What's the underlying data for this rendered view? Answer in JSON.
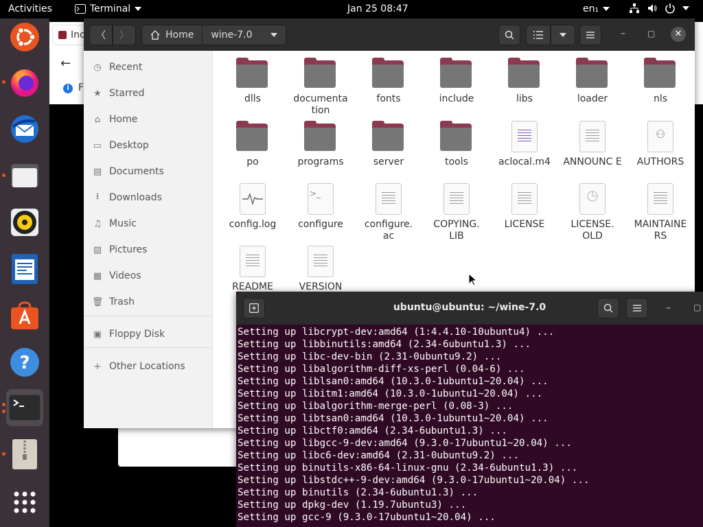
{
  "topbar": {
    "activities": "Activities",
    "app_name": "Terminal",
    "clock": "Jan 25  08:47",
    "language": "en₁"
  },
  "background_window": {
    "tab_label": "Inc",
    "info_text": "F"
  },
  "file_manager": {
    "path": [
      "Home",
      "wine-7.0"
    ],
    "sidebar": [
      {
        "label": "Recent",
        "icon": "clock-icon"
      },
      {
        "label": "Starred",
        "icon": "star-icon"
      },
      {
        "label": "Home",
        "icon": "home-icon"
      },
      {
        "label": "Desktop",
        "icon": "desktop-icon"
      },
      {
        "label": "Documents",
        "icon": "documents-icon"
      },
      {
        "label": "Downloads",
        "icon": "downloads-icon"
      },
      {
        "label": "Music",
        "icon": "music-icon"
      },
      {
        "label": "Pictures",
        "icon": "pictures-icon"
      },
      {
        "label": "Videos",
        "icon": "videos-icon"
      },
      {
        "label": "Trash",
        "icon": "trash-icon"
      },
      {
        "label": "Floppy Disk",
        "icon": "floppy-icon"
      },
      {
        "label": "Other Locations",
        "icon": "plus-icon"
      }
    ],
    "items": [
      {
        "name": "dlls",
        "type": "folder"
      },
      {
        "name": "documenta tion",
        "type": "folder"
      },
      {
        "name": "fonts",
        "type": "folder"
      },
      {
        "name": "include",
        "type": "folder"
      },
      {
        "name": "libs",
        "type": "folder"
      },
      {
        "name": "loader",
        "type": "folder"
      },
      {
        "name": "nls",
        "type": "folder"
      },
      {
        "name": "po",
        "type": "folder"
      },
      {
        "name": "programs",
        "type": "folder"
      },
      {
        "name": "server",
        "type": "folder"
      },
      {
        "name": "tools",
        "type": "folder"
      },
      {
        "name": "aclocal.m4",
        "type": "colored-text"
      },
      {
        "name": "ANNOUNC E",
        "type": "text"
      },
      {
        "name": "AUTHORS",
        "type": "people"
      },
      {
        "name": "config.log",
        "type": "log"
      },
      {
        "name": "configure",
        "type": "script"
      },
      {
        "name": "configure. ac",
        "type": "text"
      },
      {
        "name": "COPYING. LIB",
        "type": "text"
      },
      {
        "name": "LICENSE",
        "type": "text"
      },
      {
        "name": "LICENSE. OLD",
        "type": "history"
      },
      {
        "name": "MAINTAINE RS",
        "type": "text"
      },
      {
        "name": "README",
        "type": "text"
      },
      {
        "name": "VERSION",
        "type": "text"
      }
    ]
  },
  "terminal": {
    "title": "ubuntu@ubuntu: ~/wine-7.0",
    "lines": [
      "Setting up libcrypt-dev:amd64 (1:4.4.10-10ubuntu4) ...",
      "Setting up libbinutils:amd64 (2.34-6ubuntu1.3) ...",
      "Setting up libc-dev-bin (2.31-0ubuntu9.2) ...",
      "Setting up libalgorithm-diff-xs-perl (0.04-6) ...",
      "Setting up liblsan0:amd64 (10.3.0-1ubuntu1~20.04) ...",
      "Setting up libitm1:amd64 (10.3.0-1ubuntu1~20.04) ...",
      "Setting up libalgorithm-merge-perl (0.08-3) ...",
      "Setting up libtsan0:amd64 (10.3.0-1ubuntu1~20.04) ...",
      "Setting up libctf0:amd64 (2.34-6ubuntu1.3) ...",
      "Setting up libgcc-9-dev:amd64 (9.3.0-17ubuntu1~20.04) ...",
      "Setting up libc6-dev:amd64 (2.31-0ubuntu9.2) ...",
      "Setting up binutils-x86-64-linux-gnu (2.34-6ubuntu1.3) ...",
      "Setting up libstdc++-9-dev:amd64 (9.3.0-17ubuntu1~20.04) ...",
      "Setting up binutils (2.34-6ubuntu1.3) ...",
      "Setting up dpkg-dev (1.19.7ubuntu3) ...",
      "Setting up gcc-9 (9.3.0-17ubuntu1~20.04) ..."
    ]
  },
  "colors": {
    "ubuntu_orange": "#e95420",
    "terminal_bg": "#300a24",
    "folder_tab": "#8b3a52",
    "folder_body": "#767676"
  }
}
